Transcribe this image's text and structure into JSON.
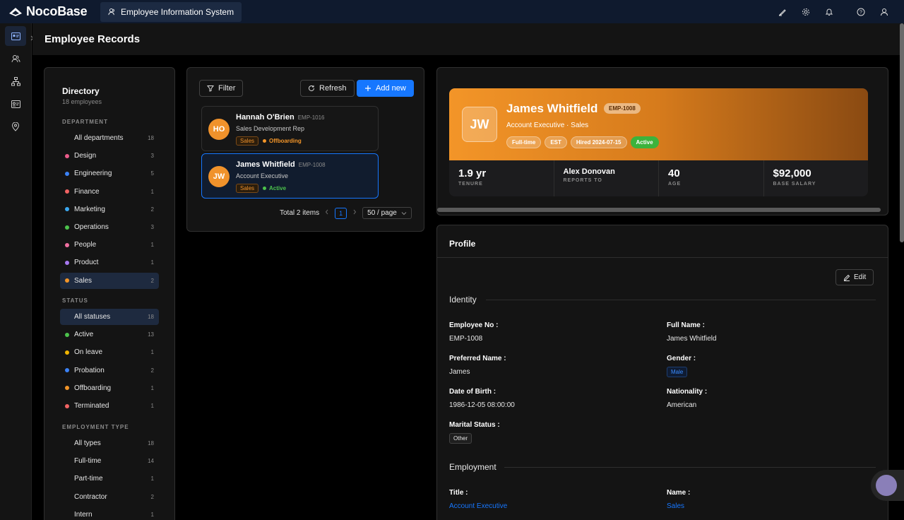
{
  "app": {
    "logo_text": "NocoBase",
    "tab_label": "Employee Information System"
  },
  "topbar": {
    "icons": [
      "highlighter-icon",
      "settings-icon",
      "bell-icon",
      "help-icon",
      "user-icon"
    ]
  },
  "rail": {
    "items": [
      "id-card-icon",
      "users-icon",
      "org-chart-icon",
      "profile-card-icon",
      "location-pin-icon"
    ]
  },
  "page": {
    "title": "Employee Records"
  },
  "directory": {
    "title": "Directory",
    "subtitle": "18 employees",
    "department_heading": "DEPARTMENT",
    "departments": [
      {
        "label": "All departments",
        "count": "18",
        "color": ""
      },
      {
        "label": "Design",
        "count": "3",
        "color": "#eb5b8a"
      },
      {
        "label": "Engineering",
        "count": "5",
        "color": "#3b82f6"
      },
      {
        "label": "Finance",
        "count": "1",
        "color": "#f16363"
      },
      {
        "label": "Marketing",
        "count": "2",
        "color": "#3aa8f0"
      },
      {
        "label": "Operations",
        "count": "3",
        "color": "#4cc34c"
      },
      {
        "label": "People",
        "count": "1",
        "color": "#f06fa0"
      },
      {
        "label": "Product",
        "count": "1",
        "color": "#a779f0"
      },
      {
        "label": "Sales",
        "count": "2",
        "color": "#f39528"
      }
    ],
    "status_heading": "STATUS",
    "statuses": [
      {
        "label": "All statuses",
        "count": "18",
        "color": ""
      },
      {
        "label": "Active",
        "count": "13",
        "color": "#4cc34c"
      },
      {
        "label": "On leave",
        "count": "1",
        "color": "#f0b400"
      },
      {
        "label": "Probation",
        "count": "2",
        "color": "#3b82f6"
      },
      {
        "label": "Offboarding",
        "count": "1",
        "color": "#f39528"
      },
      {
        "label": "Terminated",
        "count": "1",
        "color": "#f16363"
      }
    ],
    "employment_heading": "EMPLOYMENT TYPE",
    "employment_types": [
      {
        "label": "All types",
        "count": "18"
      },
      {
        "label": "Full-time",
        "count": "14"
      },
      {
        "label": "Part-time",
        "count": "1"
      },
      {
        "label": "Contractor",
        "count": "2"
      },
      {
        "label": "Intern",
        "count": "1"
      }
    ]
  },
  "list": {
    "filter_label": "Filter",
    "refresh_label": "Refresh",
    "add_label": "Add new",
    "cards": [
      {
        "initials": "HO",
        "name": "Hannah O'Brien",
        "code": "EMP-1016",
        "role": "Sales Development Rep",
        "dept": "Sales",
        "status": "Offboarding",
        "status_color": "#f39528"
      },
      {
        "initials": "JW",
        "name": "James Whitfield",
        "code": "EMP-1008",
        "role": "Account Executive",
        "dept": "Sales",
        "status": "Active",
        "status_color": "#4cc34c"
      }
    ],
    "total": "Total 2 items",
    "page": "1",
    "page_size": "50 / page"
  },
  "detail": {
    "initials": "JW",
    "name": "James Whitfield",
    "code": "EMP-1008",
    "role_line": "Account Executive · Sales",
    "pills": [
      "Full-time",
      "EST",
      "Hired 2024-07-15",
      "Active"
    ],
    "stats": [
      {
        "value": "1.9 yr",
        "label": "TENURE"
      },
      {
        "value": "Alex Donovan",
        "label": "REPORTS TO"
      },
      {
        "value": "40",
        "label": "AGE"
      },
      {
        "value": "$92,000",
        "label": "BASE SALARY"
      }
    ]
  },
  "profile": {
    "title": "Profile",
    "edit_label": "Edit",
    "identity_title": "Identity",
    "employment_title": "Employment",
    "fields": {
      "employee_no_label": "Employee No :",
      "employee_no": "EMP-1008",
      "full_name_label": "Full Name :",
      "full_name": "James Whitfield",
      "preferred_name_label": "Preferred Name :",
      "preferred_name": "James",
      "gender_label": "Gender :",
      "gender": "Male",
      "dob_label": "Date of Birth :",
      "dob": "1986-12-05 08:00:00",
      "nationality_label": "Nationality :",
      "nationality": "American",
      "marital_label": "Marital Status :",
      "marital": "Other",
      "title_label": "Title :",
      "title": "Account Executive",
      "name_label": "Name :",
      "name": "Sales"
    }
  }
}
